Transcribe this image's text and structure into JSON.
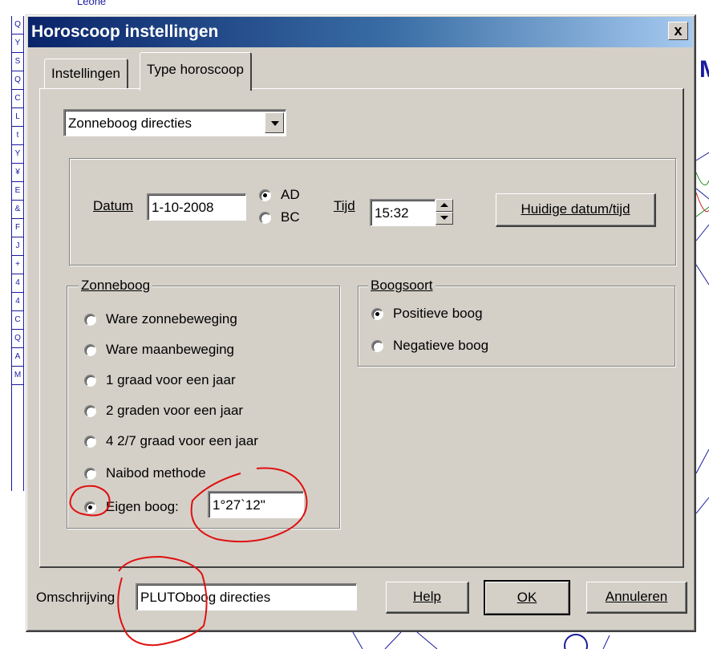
{
  "background": {
    "top_text": "Leone",
    "right_letter": "M",
    "strip_cells": [
      "Q",
      "Y",
      "S",
      "Q",
      "C",
      "L",
      "t",
      "Y",
      "¥",
      "E",
      "&",
      "F",
      "J",
      "+",
      "4",
      "4",
      "C",
      "Q",
      "A",
      "M"
    ]
  },
  "dialog": {
    "title": "Horoscoop instellingen",
    "close_label": "x"
  },
  "tabs": [
    {
      "label": "Instellingen",
      "active": false
    },
    {
      "label": "Type horoscoop",
      "active": true
    }
  ],
  "type_select": {
    "value": "Zonneboog directies"
  },
  "datetime": {
    "datum_label": "Datum",
    "datum_value": "1-10-2008",
    "era_options": [
      {
        "label": "AD",
        "checked": true
      },
      {
        "label": "BC",
        "checked": false
      }
    ],
    "tijd_label": "Tijd",
    "tijd_value": "15:32",
    "current_button": "Huidige datum/tijd"
  },
  "zonneboog": {
    "legend": "Zonneboog",
    "options": [
      {
        "label": "Ware zonnebeweging",
        "checked": false
      },
      {
        "label": "Ware maanbeweging",
        "checked": false
      },
      {
        "label": "1 graad voor een jaar",
        "checked": false
      },
      {
        "label": "2 graden voor een jaar",
        "checked": false
      },
      {
        "label": "4 2/7 graad voor een jaar",
        "checked": false
      },
      {
        "label": "Naibod methode",
        "checked": false
      },
      {
        "label": "Eigen boog:",
        "checked": true
      }
    ],
    "eigen_boog_value": "1°27`12\""
  },
  "boogsoort": {
    "legend": "Boogsoort",
    "options": [
      {
        "label": "Positieve boog",
        "checked": true
      },
      {
        "label": "Negatieve boog",
        "checked": false
      }
    ]
  },
  "footer": {
    "omschrijving_label": "Omschrijving",
    "omschrijving_value": "PLUTOboog directies",
    "help_button": "Help",
    "ok_button": "OK",
    "cancel_button": "Annuleren"
  },
  "colors": {
    "title_start": "#0a246a",
    "title_end": "#a6caf0",
    "dialog_face": "#d4d0c8",
    "annotation_red": "#e01010"
  }
}
